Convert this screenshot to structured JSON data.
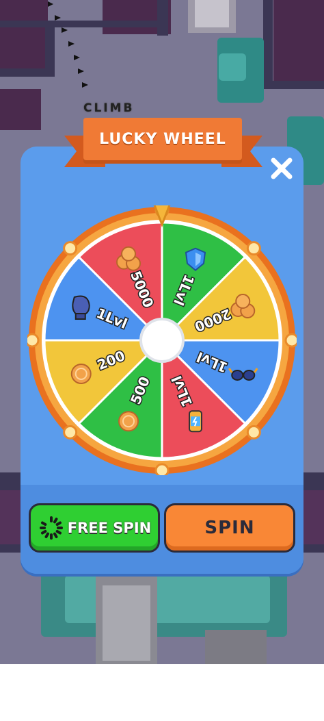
{
  "scene": {
    "hint_text": "CLIMB"
  },
  "dialog": {
    "title": "LUCKY WHEEL",
    "close_icon": "close-x-icon"
  },
  "wheel": {
    "segments": [
      {
        "label": "1Lvl",
        "icon": "shield-icon",
        "color": "#2fbf45"
      },
      {
        "label": "2000",
        "icon": "coins-pile-icon",
        "color": "#f2c63a"
      },
      {
        "label": "1Lvl",
        "icon": "sunglasses-icon",
        "color": "#4d93f0"
      },
      {
        "label": "1Lvl",
        "icon": "energy-can-icon",
        "color": "#ec4d5a"
      },
      {
        "label": "500",
        "icon": "coin-icon",
        "color": "#2fbf45"
      },
      {
        "label": "200",
        "icon": "coin-icon",
        "color": "#f2c63a"
      },
      {
        "label": "1Lvl",
        "icon": "glove-icon",
        "color": "#4d93f0"
      },
      {
        "label": "5000",
        "icon": "coins-pile-icon",
        "color": "#ec4d5a"
      }
    ],
    "rim_color": "#f28a2e",
    "pointer_color": "#f5b63a"
  },
  "buttons": {
    "free_spin": "FREE SPIN",
    "spin": "SPIN"
  }
}
